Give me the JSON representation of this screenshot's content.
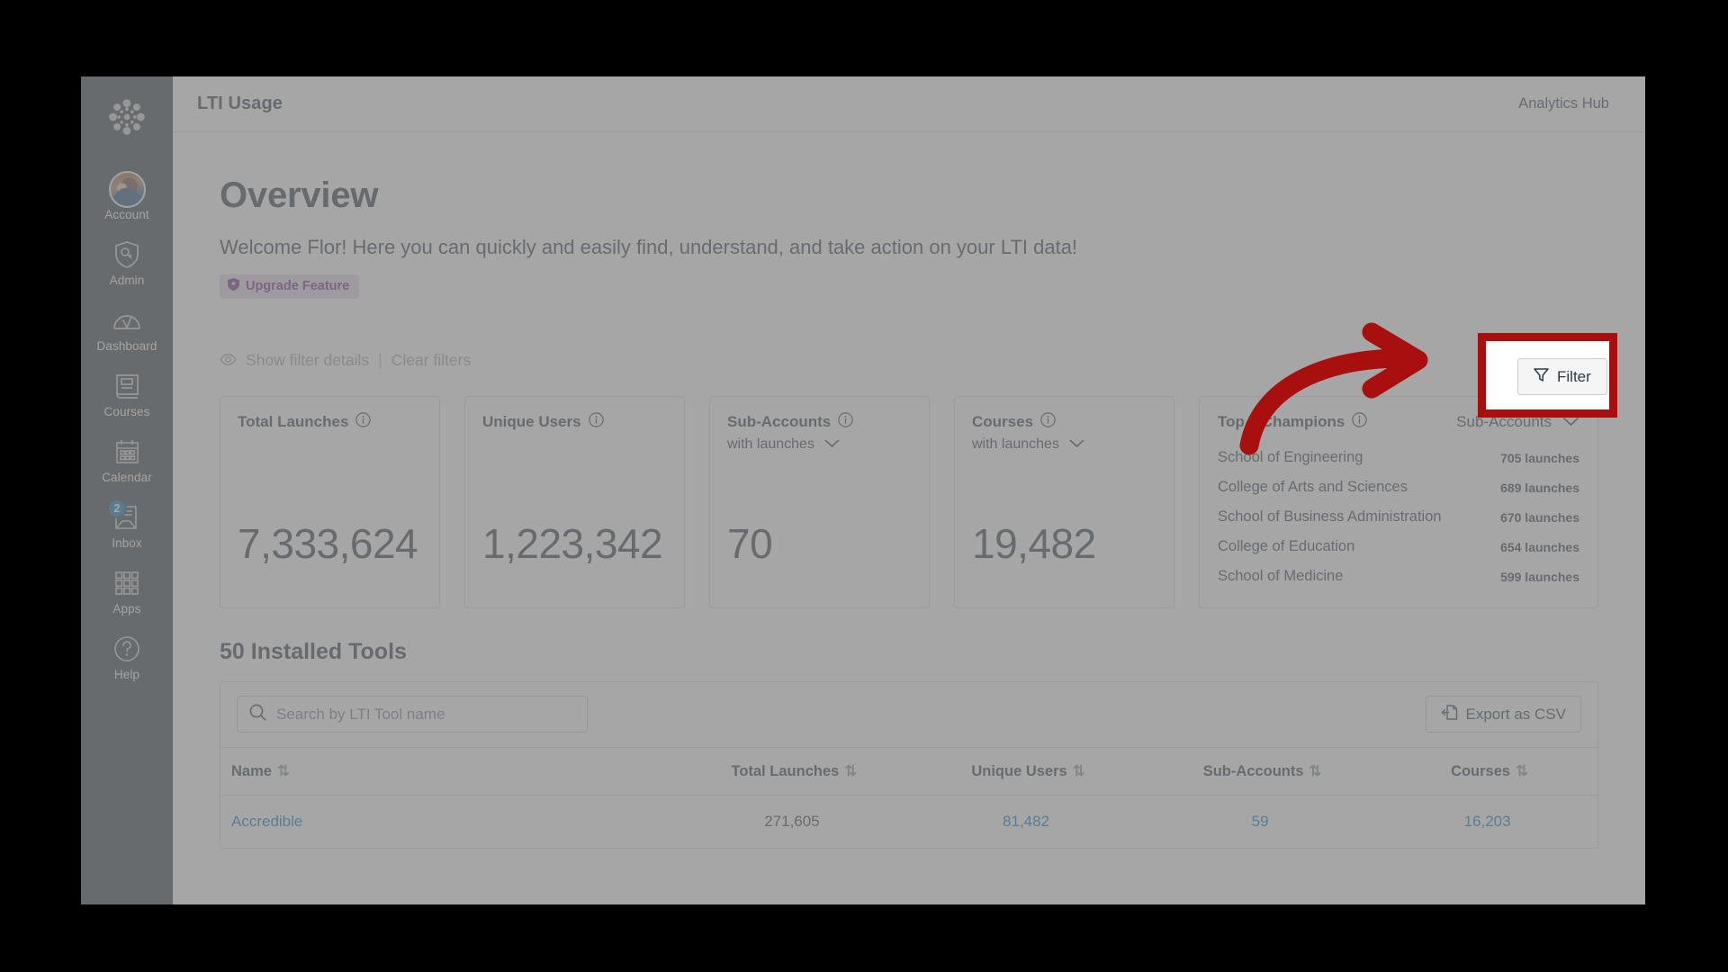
{
  "window": {
    "app_title": "LTI Usage",
    "hub_name": "Analytics Hub"
  },
  "sidebar": {
    "logo": "canvas-logo",
    "items": [
      {
        "label": "Account",
        "icon": "avatar-icon",
        "badge": ""
      },
      {
        "label": "Admin",
        "icon": "shield-key-icon",
        "badge": ""
      },
      {
        "label": "Dashboard",
        "icon": "gauge-icon",
        "badge": ""
      },
      {
        "label": "Courses",
        "icon": "book-icon",
        "badge": ""
      },
      {
        "label": "Calendar",
        "icon": "calendar-icon",
        "badge": ""
      },
      {
        "label": "Inbox",
        "icon": "inbox-icon",
        "badge": "2"
      },
      {
        "label": "Apps",
        "icon": "grid-icon",
        "badge": ""
      },
      {
        "label": "Help",
        "icon": "question-circle-icon",
        "badge": ""
      }
    ]
  },
  "overview": {
    "title": "Overview",
    "welcome": "Welcome Flor! Here you can quickly and easily find, understand, and take action on your LTI data!",
    "upgrade_badge": "Upgrade Feature",
    "show_filter_details": "Show filter details",
    "separator": "|",
    "clear_filters": "Clear filters",
    "filter_button": "Filter"
  },
  "cards": {
    "metrics": [
      {
        "title": "Total Launches",
        "value": "7,333,624",
        "sub": ""
      },
      {
        "title": "Unique Users",
        "value": "1,223,342",
        "sub": ""
      },
      {
        "title": "Sub-Accounts",
        "value": "70",
        "sub": "with launches"
      },
      {
        "title": "Courses",
        "value": "19,482",
        "sub": "with launches"
      }
    ],
    "champions": {
      "title": "Top 5 Champions",
      "scope": "Sub-Accounts",
      "rows": [
        {
          "name": "School of Engineering",
          "count": "705 launches"
        },
        {
          "name": "College of Arts and Sciences",
          "count": "689 launches"
        },
        {
          "name": "School of Business Administration",
          "count": "670 launches"
        },
        {
          "name": "College of Education",
          "count": "654 launches"
        },
        {
          "name": "School of Medicine",
          "count": "599 launches"
        }
      ]
    }
  },
  "tools": {
    "heading": "50 Installed Tools",
    "search_placeholder": "Search by LTI Tool name",
    "search_value": "",
    "export_label": "Export as CSV",
    "columns": [
      "Name",
      "Total Launches",
      "Unique Users",
      "Sub-Accounts",
      "Courses"
    ],
    "rows": [
      {
        "name": "Accredible",
        "total_launches": "271,605",
        "unique_users": "81,482",
        "sub_accounts": "59",
        "courses": "16,203"
      }
    ]
  },
  "annotation": {
    "arrow": "red-curved-arrow",
    "highlight_target": "Filter",
    "highlight_color": "#a80f0f"
  }
}
